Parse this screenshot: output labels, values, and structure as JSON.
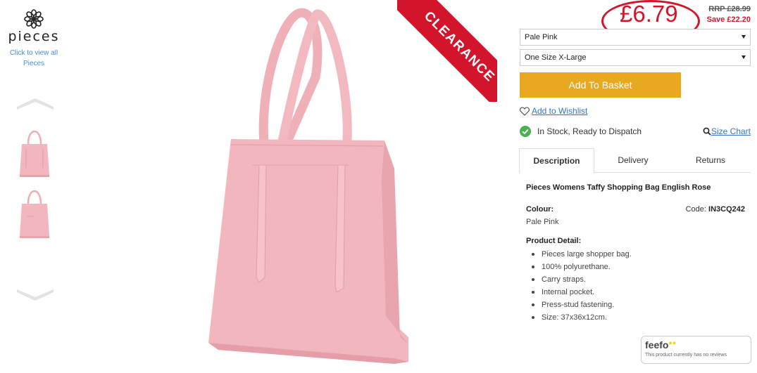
{
  "brand": {
    "name": "pieces",
    "link_line1": "Click to view all",
    "link_line2": "Pieces"
  },
  "banner": {
    "label": "CLEARANCE",
    "color": "#d3152b"
  },
  "price": {
    "current": "£6.79",
    "rrp": "RRP £28.99",
    "save": "Save £22.20"
  },
  "options": {
    "colour_selected": "Pale Pink",
    "size_selected": "One Size X-Large"
  },
  "actions": {
    "add_to_basket": "Add To Basket",
    "wishlist": "Add to Wishlist",
    "size_chart": "Size Chart"
  },
  "stock": {
    "text": "In Stock, Ready to Dispatch"
  },
  "tabs": [
    {
      "label": "Description",
      "active": true
    },
    {
      "label": "Delivery",
      "active": false
    },
    {
      "label": "Returns",
      "active": false
    }
  ],
  "description": {
    "title": "Pieces Womens Taffy Shopping Bag English Rose",
    "colour_label": "Colour:",
    "colour_value": "Pale Pink",
    "code_label": "Code:",
    "code_value": "IN3CQ242",
    "detail_label": "Product Detail:",
    "details": [
      "Pieces large shopper bag.",
      "100% polyurethane.",
      "Carry straps.",
      "Internal pocket.",
      "Press-stud fastening.",
      "Size: 37x36x12cm."
    ]
  },
  "feefo": {
    "logo": "feefo",
    "text": "This product currently has no reviews"
  },
  "colors": {
    "accent_red": "#d3152b",
    "basket_orange": "#e8a921",
    "link_blue": "#2f77c6",
    "bag_pink": "#f2b7be"
  }
}
